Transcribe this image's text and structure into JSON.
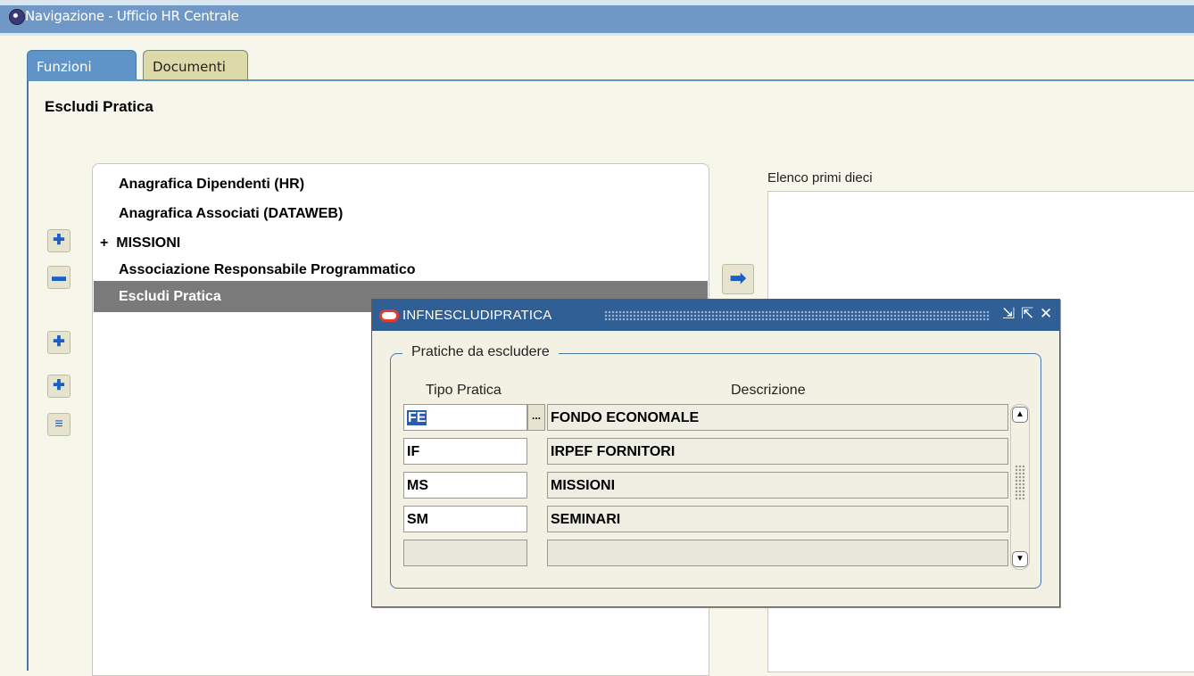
{
  "window": {
    "title": "Navigazione - Ufficio HR Centrale"
  },
  "tabs": [
    {
      "label": "Funzioni",
      "active": true
    },
    {
      "label": "Documenti",
      "active": false
    }
  ],
  "section_title": "Escludi Pratica",
  "tree": {
    "items": [
      {
        "label": "Anagrafica Dipendenti (HR)",
        "prefix": ""
      },
      {
        "label": "Anagrafica Associati (DATAWEB)",
        "prefix": ""
      },
      {
        "label": "MISSIONI",
        "prefix": "+"
      },
      {
        "label": "Associazione Responsabile Programmatico",
        "prefix": ""
      },
      {
        "label": "Escludi Pratica",
        "prefix": "",
        "selected": true
      }
    ]
  },
  "side_buttons": [
    "expand-icon",
    "collapse-icon",
    "expand-branch-icon",
    "expand-all-icon",
    "collapse-all-icon"
  ],
  "arrow_button_icon": "right-arrow-icon",
  "list_panel": {
    "label": "Elenco primi dieci"
  },
  "dialog": {
    "title": "INFNESCLUDIPRATICA",
    "controls": [
      "minimize-icon",
      "maximize-icon",
      "close-icon"
    ],
    "group_label": "Pratiche da escludere",
    "columns": [
      "Tipo Pratica",
      "Descrizione"
    ],
    "rows": [
      {
        "code": "FE",
        "description": "FONDO ECONOMALE",
        "focused": true
      },
      {
        "code": "IF",
        "description": "IRPEF FORNITORI"
      },
      {
        "code": "MS",
        "description": "MISSIONI"
      },
      {
        "code": "SM",
        "description": "SEMINARI"
      },
      {
        "code": "",
        "description": ""
      }
    ],
    "lov_label": "..."
  },
  "colors": {
    "title_bar": "#6f98c7",
    "tab_active": "#5f94c9",
    "selection": "#7a7a7a",
    "dialog_title": "#2f5f94",
    "focus": "#2a5db0"
  }
}
